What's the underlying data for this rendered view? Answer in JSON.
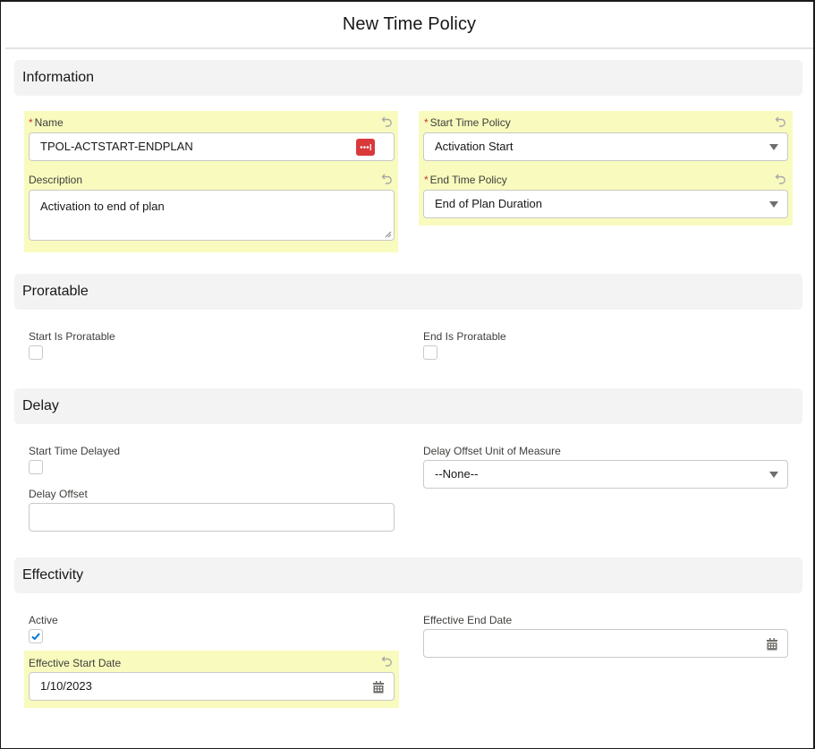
{
  "header": {
    "title": "New Time Policy"
  },
  "sections": {
    "information": {
      "title": "Information",
      "name": {
        "label": "Name",
        "required": true,
        "value": "TPOL-ACTSTART-ENDPLAN",
        "icon": "password-manager-icon"
      },
      "description": {
        "label": "Description",
        "value": "Activation to end of plan"
      },
      "start_time_policy": {
        "label": "Start Time Policy",
        "required": true,
        "value": "Activation Start"
      },
      "end_time_policy": {
        "label": "End Time Policy",
        "required": true,
        "value": "End of Plan Duration"
      }
    },
    "proratable": {
      "title": "Proratable",
      "start_is_proratable": {
        "label": "Start Is Proratable",
        "checked": false
      },
      "end_is_proratable": {
        "label": "End Is Proratable",
        "checked": false
      }
    },
    "delay": {
      "title": "Delay",
      "start_time_delayed": {
        "label": "Start Time Delayed",
        "checked": false
      },
      "delay_offset": {
        "label": "Delay Offset",
        "value": ""
      },
      "delay_offset_unit": {
        "label": "Delay Offset Unit of Measure",
        "value": "--None--"
      }
    },
    "effectivity": {
      "title": "Effectivity",
      "active": {
        "label": "Active",
        "checked": true
      },
      "effective_start_date": {
        "label": "Effective Start Date",
        "value": "1/10/2023"
      },
      "effective_end_date": {
        "label": "Effective End Date",
        "value": ""
      }
    }
  },
  "required_marker": "*",
  "colors": {
    "highlight": "#f8fbbd",
    "required": "#c23934",
    "check": "#0176d3",
    "section_bg": "#f3f3f3"
  }
}
